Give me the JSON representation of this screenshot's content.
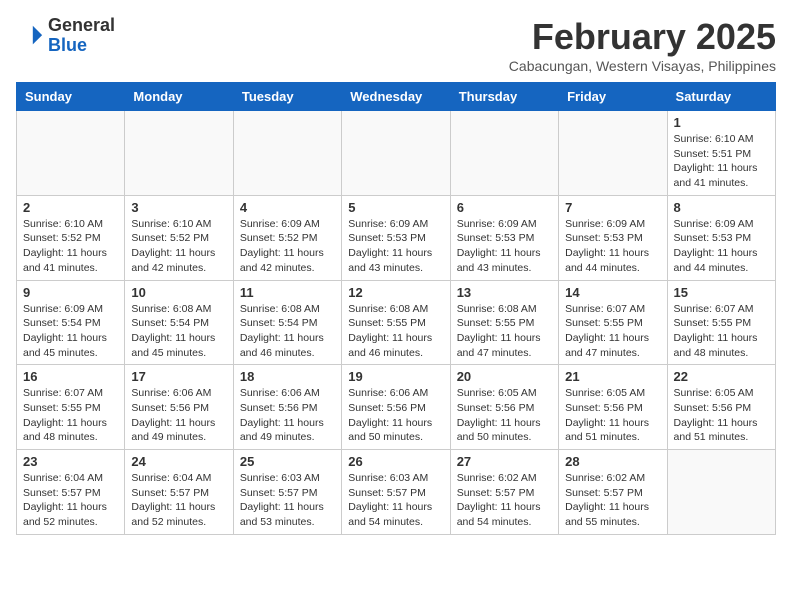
{
  "header": {
    "logo_general": "General",
    "logo_blue": "Blue",
    "month_year": "February 2025",
    "location": "Cabacungan, Western Visayas, Philippines"
  },
  "weekdays": [
    "Sunday",
    "Monday",
    "Tuesday",
    "Wednesday",
    "Thursday",
    "Friday",
    "Saturday"
  ],
  "weeks": [
    [
      {
        "day": "",
        "info": ""
      },
      {
        "day": "",
        "info": ""
      },
      {
        "day": "",
        "info": ""
      },
      {
        "day": "",
        "info": ""
      },
      {
        "day": "",
        "info": ""
      },
      {
        "day": "",
        "info": ""
      },
      {
        "day": "1",
        "info": "Sunrise: 6:10 AM\nSunset: 5:51 PM\nDaylight: 11 hours\nand 41 minutes."
      }
    ],
    [
      {
        "day": "2",
        "info": "Sunrise: 6:10 AM\nSunset: 5:52 PM\nDaylight: 11 hours\nand 41 minutes."
      },
      {
        "day": "3",
        "info": "Sunrise: 6:10 AM\nSunset: 5:52 PM\nDaylight: 11 hours\nand 42 minutes."
      },
      {
        "day": "4",
        "info": "Sunrise: 6:09 AM\nSunset: 5:52 PM\nDaylight: 11 hours\nand 42 minutes."
      },
      {
        "day": "5",
        "info": "Sunrise: 6:09 AM\nSunset: 5:53 PM\nDaylight: 11 hours\nand 43 minutes."
      },
      {
        "day": "6",
        "info": "Sunrise: 6:09 AM\nSunset: 5:53 PM\nDaylight: 11 hours\nand 43 minutes."
      },
      {
        "day": "7",
        "info": "Sunrise: 6:09 AM\nSunset: 5:53 PM\nDaylight: 11 hours\nand 44 minutes."
      },
      {
        "day": "8",
        "info": "Sunrise: 6:09 AM\nSunset: 5:53 PM\nDaylight: 11 hours\nand 44 minutes."
      }
    ],
    [
      {
        "day": "9",
        "info": "Sunrise: 6:09 AM\nSunset: 5:54 PM\nDaylight: 11 hours\nand 45 minutes."
      },
      {
        "day": "10",
        "info": "Sunrise: 6:08 AM\nSunset: 5:54 PM\nDaylight: 11 hours\nand 45 minutes."
      },
      {
        "day": "11",
        "info": "Sunrise: 6:08 AM\nSunset: 5:54 PM\nDaylight: 11 hours\nand 46 minutes."
      },
      {
        "day": "12",
        "info": "Sunrise: 6:08 AM\nSunset: 5:55 PM\nDaylight: 11 hours\nand 46 minutes."
      },
      {
        "day": "13",
        "info": "Sunrise: 6:08 AM\nSunset: 5:55 PM\nDaylight: 11 hours\nand 47 minutes."
      },
      {
        "day": "14",
        "info": "Sunrise: 6:07 AM\nSunset: 5:55 PM\nDaylight: 11 hours\nand 47 minutes."
      },
      {
        "day": "15",
        "info": "Sunrise: 6:07 AM\nSunset: 5:55 PM\nDaylight: 11 hours\nand 48 minutes."
      }
    ],
    [
      {
        "day": "16",
        "info": "Sunrise: 6:07 AM\nSunset: 5:55 PM\nDaylight: 11 hours\nand 48 minutes."
      },
      {
        "day": "17",
        "info": "Sunrise: 6:06 AM\nSunset: 5:56 PM\nDaylight: 11 hours\nand 49 minutes."
      },
      {
        "day": "18",
        "info": "Sunrise: 6:06 AM\nSunset: 5:56 PM\nDaylight: 11 hours\nand 49 minutes."
      },
      {
        "day": "19",
        "info": "Sunrise: 6:06 AM\nSunset: 5:56 PM\nDaylight: 11 hours\nand 50 minutes."
      },
      {
        "day": "20",
        "info": "Sunrise: 6:05 AM\nSunset: 5:56 PM\nDaylight: 11 hours\nand 50 minutes."
      },
      {
        "day": "21",
        "info": "Sunrise: 6:05 AM\nSunset: 5:56 PM\nDaylight: 11 hours\nand 51 minutes."
      },
      {
        "day": "22",
        "info": "Sunrise: 6:05 AM\nSunset: 5:56 PM\nDaylight: 11 hours\nand 51 minutes."
      }
    ],
    [
      {
        "day": "23",
        "info": "Sunrise: 6:04 AM\nSunset: 5:57 PM\nDaylight: 11 hours\nand 52 minutes."
      },
      {
        "day": "24",
        "info": "Sunrise: 6:04 AM\nSunset: 5:57 PM\nDaylight: 11 hours\nand 52 minutes."
      },
      {
        "day": "25",
        "info": "Sunrise: 6:03 AM\nSunset: 5:57 PM\nDaylight: 11 hours\nand 53 minutes."
      },
      {
        "day": "26",
        "info": "Sunrise: 6:03 AM\nSunset: 5:57 PM\nDaylight: 11 hours\nand 54 minutes."
      },
      {
        "day": "27",
        "info": "Sunrise: 6:02 AM\nSunset: 5:57 PM\nDaylight: 11 hours\nand 54 minutes."
      },
      {
        "day": "28",
        "info": "Sunrise: 6:02 AM\nSunset: 5:57 PM\nDaylight: 11 hours\nand 55 minutes."
      },
      {
        "day": "",
        "info": ""
      }
    ]
  ]
}
